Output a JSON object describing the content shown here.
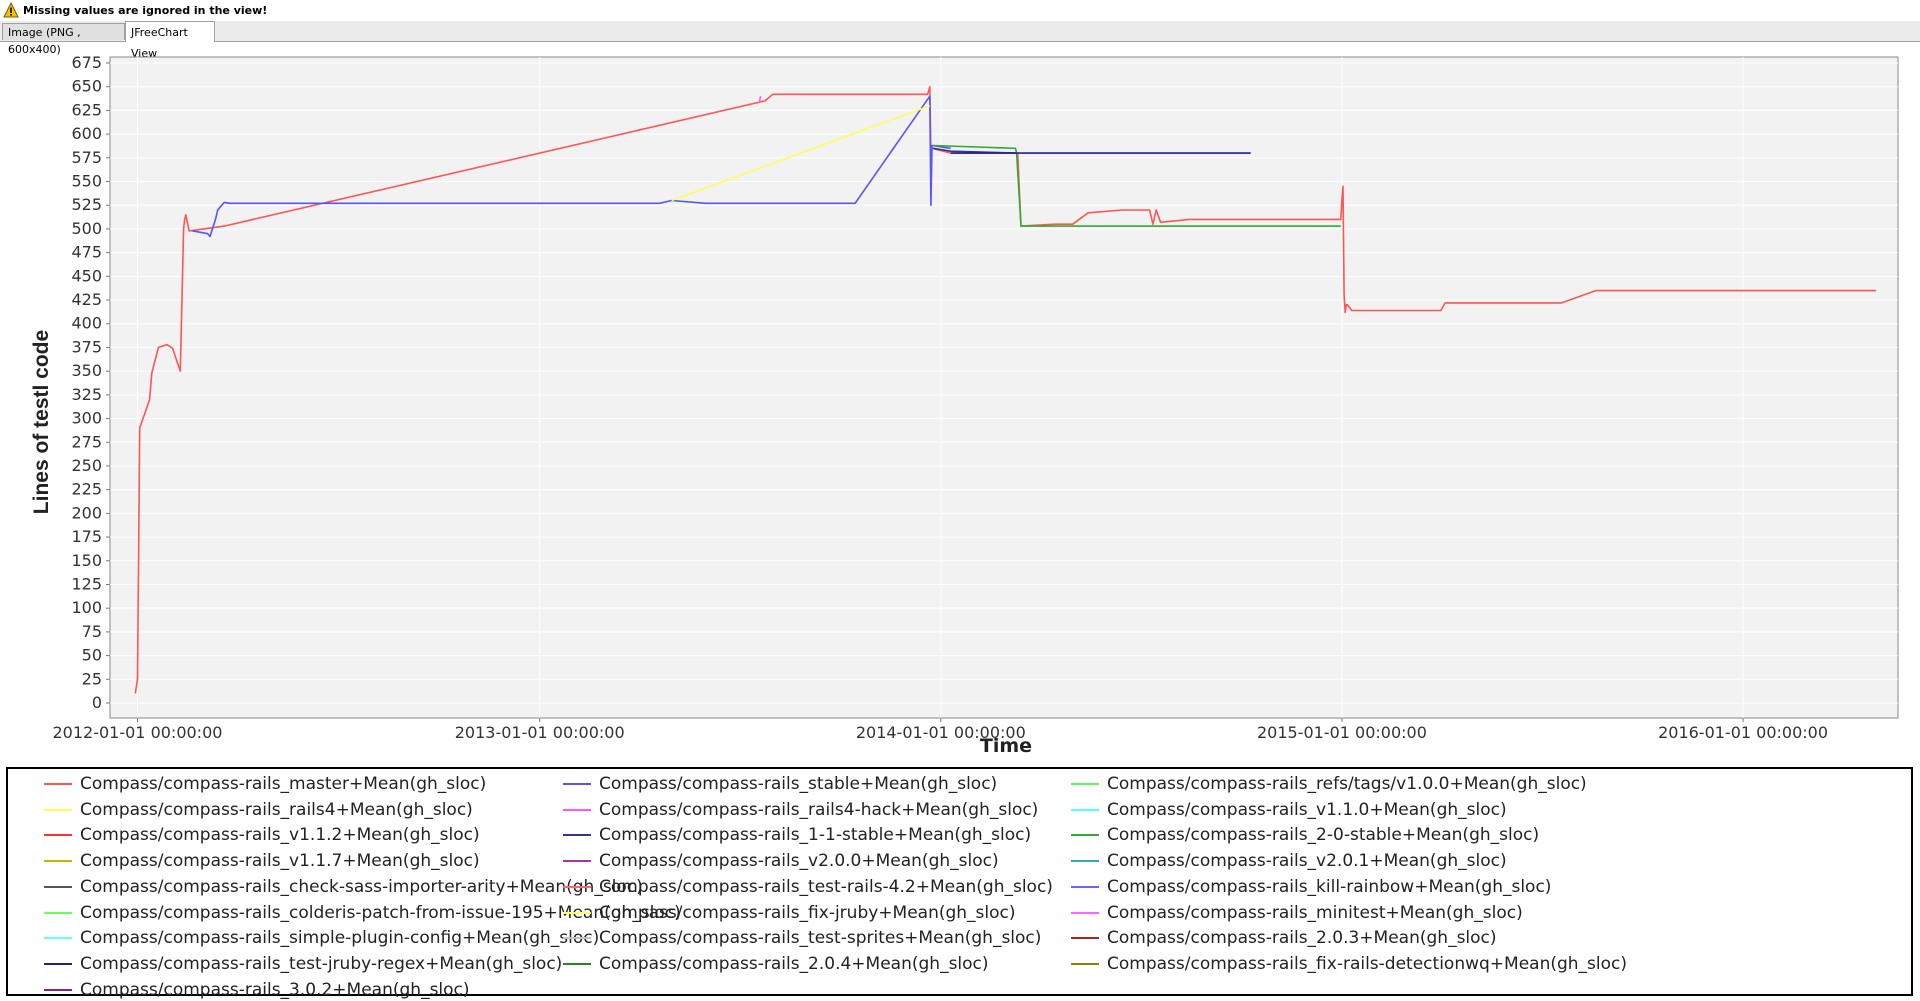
{
  "warning": {
    "text": "Missing values are ignored in the view!"
  },
  "tabs": [
    {
      "label": "Image (PNG , 600x400)",
      "active": false
    },
    {
      "label": "JFreeChart View",
      "active": true
    }
  ],
  "chart_data": {
    "type": "line",
    "title": "",
    "xlabel": "Time",
    "ylabel": "Lines of testl code",
    "x_type": "date",
    "xlim": [
      "2011-12-07",
      "2016-05-21"
    ],
    "ylim": [
      0,
      675
    ],
    "y_ticks": [
      0,
      25,
      50,
      75,
      100,
      125,
      150,
      175,
      200,
      225,
      250,
      275,
      300,
      325,
      350,
      375,
      400,
      425,
      450,
      475,
      500,
      525,
      550,
      575,
      600,
      625,
      650,
      675
    ],
    "x_ticks": [
      "2012-01-01 00:00:00",
      "2013-01-01 00:00:00",
      "2014-01-01 00:00:00",
      "2015-01-01 00:00:00",
      "2016-01-01 00:00:00"
    ],
    "grid": true,
    "legend_position": "bottom",
    "series": [
      {
        "name": "Compass/compass-rails_master+Mean(gh_sloc)",
        "color": "#ff5555",
        "x": [
          "2011-12-30",
          "2012-01-01",
          "2012-01-03",
          "2012-01-12",
          "2012-01-14",
          "2012-01-20",
          "2012-01-28",
          "2012-02-02",
          "2012-02-09",
          "2012-02-12",
          "2012-02-13",
          "2012-02-14",
          "2012-02-17",
          "2012-02-18",
          "2012-03-20",
          "2013-07-25",
          "2013-08-01",
          "2013-12-20",
          "2013-12-22",
          "2013-12-23",
          "2013-12-24",
          "2014-01-10",
          "2014-02-10",
          "2014-03-12",
          "2014-03-15",
          "2014-04-15",
          "2014-05-01",
          "2014-05-15",
          "2014-06-15",
          "2014-07-10",
          "2014-07-13",
          "2014-07-16",
          "2014-07-20",
          "2014-08-15",
          "2014-12-31",
          "2015-01-01",
          "2015-01-02",
          "2015-01-03",
          "2015-01-04",
          "2015-01-05",
          "2015-01-06",
          "2015-01-10",
          "2015-04-01",
          "2015-04-05",
          "2015-07-20",
          "2015-08-20",
          "2016-05-01"
        ],
        "y": [
          10,
          25,
          290,
          320,
          348,
          375,
          378,
          374,
          350,
          500,
          510,
          515,
          498,
          498,
          503,
          635,
          642,
          642,
          650,
          580,
          585,
          580,
          580,
          580,
          503,
          505,
          505,
          517,
          520,
          520,
          505,
          520,
          507,
          510,
          510,
          530,
          545,
          430,
          412,
          420,
          420,
          414,
          414,
          422,
          422,
          435,
          435
        ]
      },
      {
        "name": "Compass/compass-rails_stable+Mean(gh_sloc)",
        "color": "#5555ff",
        "x": [
          "2012-02-20",
          "2012-03-05",
          "2012-03-07",
          "2012-03-10",
          "2012-03-12",
          "2012-03-14",
          "2012-03-17",
          "2012-03-20",
          "2012-03-25",
          "2013-04-20",
          "2013-05-01",
          "2013-06-01",
          "2013-10-15",
          "2013-12-22",
          "2013-12-23",
          "2013-12-24",
          "2014-01-10"
        ],
        "y": [
          498,
          495,
          492,
          503,
          510,
          520,
          524,
          528,
          527,
          527,
          530,
          527,
          527,
          640,
          525,
          588,
          585
        ]
      },
      {
        "name": "Compass/compass-rails_refs/tags/v1.0.0+Mean(gh_sloc)",
        "color": "#55ff55",
        "x": [],
        "y": []
      },
      {
        "name": "Compass/compass-rails_rails4+Mean(gh_sloc)",
        "color": "#ffff55",
        "x": [
          "2013-05-01",
          "2013-12-22"
        ],
        "y": [
          530,
          630
        ]
      },
      {
        "name": "Compass/compass-rails_rails4-hack+Mean(gh_sloc)",
        "color": "#ff55ff",
        "x": [
          "2013-07-20",
          "2013-07-21"
        ],
        "y": [
          635,
          640
        ]
      },
      {
        "name": "Compass/compass-rails_v1.1.0+Mean(gh_sloc)",
        "color": "#55ffff",
        "x": [],
        "y": []
      },
      {
        "name": "Compass/compass-rails_v1.1.2+Mean(gh_sloc)",
        "color": "#ff3333",
        "x": [],
        "y": []
      },
      {
        "name": "Compass/compass-rails_1-1-stable+Mean(gh_sloc)",
        "color": "#333399",
        "x": [
          "2013-12-25",
          "2014-01-10",
          "2014-03-10"
        ],
        "y": [
          585,
          582,
          580
        ]
      },
      {
        "name": "Compass/compass-rails_2-0-stable+Mean(gh_sloc)",
        "color": "#33aa33",
        "x": [
          "2013-12-25",
          "2014-03-10",
          "2014-03-11",
          "2014-03-15",
          "2014-12-31"
        ],
        "y": [
          588,
          585,
          580,
          503,
          503
        ]
      },
      {
        "name": "Compass/compass-rails_v1.1.7+Mean(gh_sloc)",
        "color": "#c8b400",
        "x": [],
        "y": []
      },
      {
        "name": "Compass/compass-rails_v2.0.0+Mean(gh_sloc)",
        "color": "#aa33aa",
        "x": [],
        "y": []
      },
      {
        "name": "Compass/compass-rails_v2.0.1+Mean(gh_sloc)",
        "color": "#33aaaa",
        "x": [],
        "y": []
      },
      {
        "name": "Compass/compass-rails_check-sass-importer-arity+Mean(gh_sloc)",
        "color": "#555555",
        "x": [],
        "y": []
      },
      {
        "name": "Compass/compass-rails_test-rails-4.2+Mean(gh_sloc)",
        "color": "#ff6666",
        "x": [],
        "y": []
      },
      {
        "name": "Compass/compass-rails_kill-rainbow+Mean(gh_sloc)",
        "color": "#6666ff",
        "x": [],
        "y": []
      },
      {
        "name": "Compass/compass-rails_colderis-patch-from-issue-195+Mean(gh_sloc)",
        "color": "#66ff66",
        "x": [],
        "y": []
      },
      {
        "name": "Compass/compass-rails_fix-jruby+Mean(gh_sloc)",
        "color": "#ffff66",
        "x": [],
        "y": []
      },
      {
        "name": "Compass/compass-rails_minitest+Mean(gh_sloc)",
        "color": "#ff66ff",
        "x": [],
        "y": []
      },
      {
        "name": "Compass/compass-rails_simple-plugin-config+Mean(gh_sloc)",
        "color": "#66ffff",
        "x": [],
        "y": []
      },
      {
        "name": "Compass/compass-rails_test-sprites+Mean(gh_sloc)",
        "color": "#c0c0c0",
        "x": [],
        "y": []
      },
      {
        "name": "Compass/compass-rails_2.0.3+Mean(gh_sloc)",
        "color": "#aa2222",
        "x": [],
        "y": []
      },
      {
        "name": "Compass/compass-rails_test-jruby-regex+Mean(gh_sloc)",
        "color": "#222288",
        "x": [
          "2014-01-10",
          "2014-10-10"
        ],
        "y": [
          580,
          580
        ]
      },
      {
        "name": "Compass/compass-rails_2.0.4+Mean(gh_sloc)",
        "color": "#228822",
        "x": [],
        "y": []
      },
      {
        "name": "Compass/compass-rails_fix-rails-detectionwq+Mean(gh_sloc)",
        "color": "#888800",
        "x": [],
        "y": []
      },
      {
        "name": "Compass/compass-rails_3.0.2+Mean(gh_sloc)",
        "color": "#882288",
        "x": [],
        "y": []
      }
    ]
  }
}
